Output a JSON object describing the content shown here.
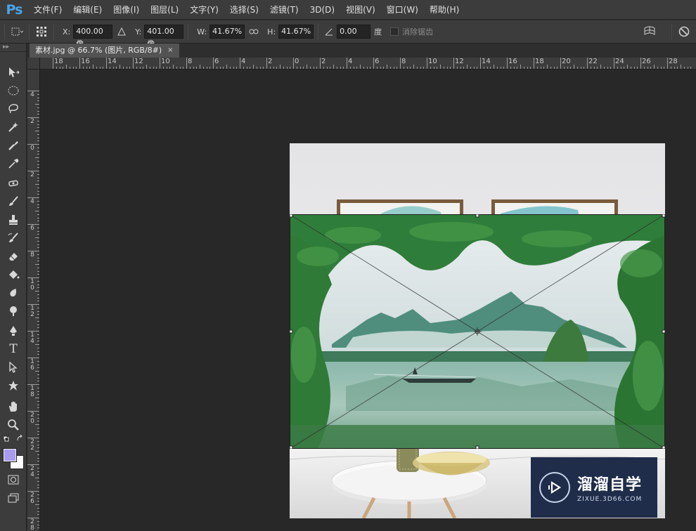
{
  "app": {
    "logo": "Ps"
  },
  "menu": [
    "文件(F)",
    "编辑(E)",
    "图像(I)",
    "图层(L)",
    "文字(Y)",
    "选择(S)",
    "滤镜(T)",
    "3D(D)",
    "视图(V)",
    "窗口(W)",
    "帮助(H)"
  ],
  "options": {
    "x_label": "X:",
    "x_value": "400.00 像",
    "y_label": "Y:",
    "y_value": "401.00 像",
    "w_label": "W:",
    "w_value": "41.67%",
    "h_label": "H:",
    "h_value": "41.67%",
    "angle_value": "0.00",
    "angle_unit": "度",
    "antialias_label": "消除锯齿"
  },
  "document": {
    "tab_title": "素材.jpg @ 66.7% (图片, RGB/8#)",
    "close": "×"
  },
  "ruler": {
    "top_labels": [
      "18",
      "16",
      "14",
      "12",
      "10",
      "8",
      "6",
      "4",
      "2",
      "0",
      "2",
      "4",
      "6",
      "8",
      "10",
      "12",
      "14",
      "16",
      "18",
      "20",
      "22",
      "24",
      "26",
      "28"
    ],
    "left_labels": [
      "4",
      "2",
      "0",
      "2",
      "4",
      "6",
      "8",
      "1\n0",
      "1\n2",
      "1\n4",
      "1\n6",
      "1\n8",
      "2\n0",
      "2\n2",
      "2\n4",
      "2\n6",
      "2\n8"
    ]
  },
  "watermark": {
    "title": "溜溜自学",
    "subtitle": "ZIXUE.3D66.COM"
  },
  "colors": {
    "foreground": "#a99cf0",
    "background": "#ffffff",
    "accent": "#4ba3e6"
  },
  "tools": [
    "move-tool",
    "marquee-tool",
    "lasso-tool",
    "magic-wand-tool",
    "crop-tool",
    "eyedropper-tool",
    "healing-brush-tool",
    "brush-tool",
    "clone-stamp-tool",
    "history-brush-tool",
    "eraser-tool",
    "paint-bucket-tool",
    "blur-tool",
    "dodge-tool",
    "pen-tool",
    "type-tool",
    "path-selection-tool",
    "shape-tool",
    "hand-tool",
    "zoom-tool"
  ]
}
